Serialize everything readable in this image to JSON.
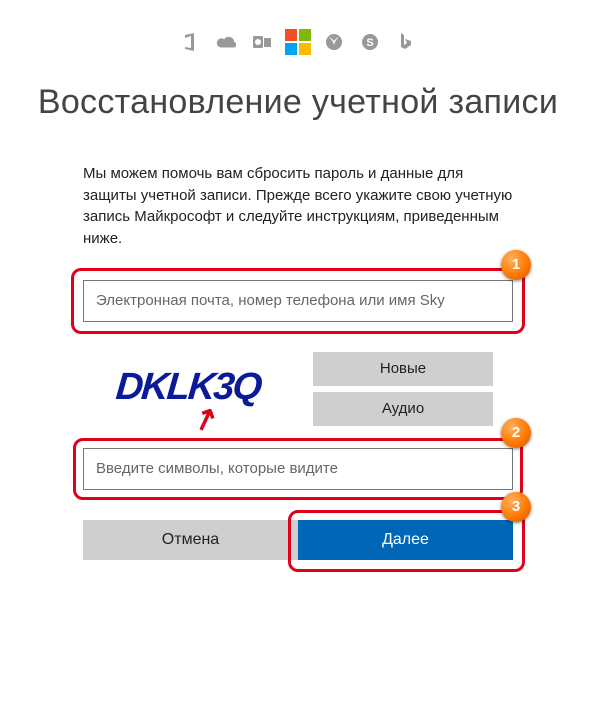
{
  "icons": [
    "office-icon",
    "onedrive-icon",
    "outlook-icon",
    "microsoft-logo",
    "xbox-icon",
    "skype-icon",
    "bing-icon"
  ],
  "title": "Восстановление учетной записи",
  "description": "Мы можем помочь вам сбросить пароль и данные для защиты учетной записи. Прежде всего укажите свою учетную запись Майкрософт и следуйте инструкциям, приведенным ниже.",
  "account_input": {
    "placeholder": "Электронная почта, номер телефона или имя Sky",
    "value": ""
  },
  "captcha": {
    "text": "DKLK3Q",
    "new_label": "Новые",
    "audio_label": "Аудио",
    "input_placeholder": "Введите символы, которые видите",
    "input_value": ""
  },
  "actions": {
    "cancel": "Отмена",
    "next": "Далее"
  },
  "annotations": {
    "badge1": "1",
    "badge2": "2",
    "badge3": "3"
  },
  "colors": {
    "primary": "#0067b8",
    "annotation": "#e1001a",
    "captcha_ink": "#0a1a99"
  }
}
